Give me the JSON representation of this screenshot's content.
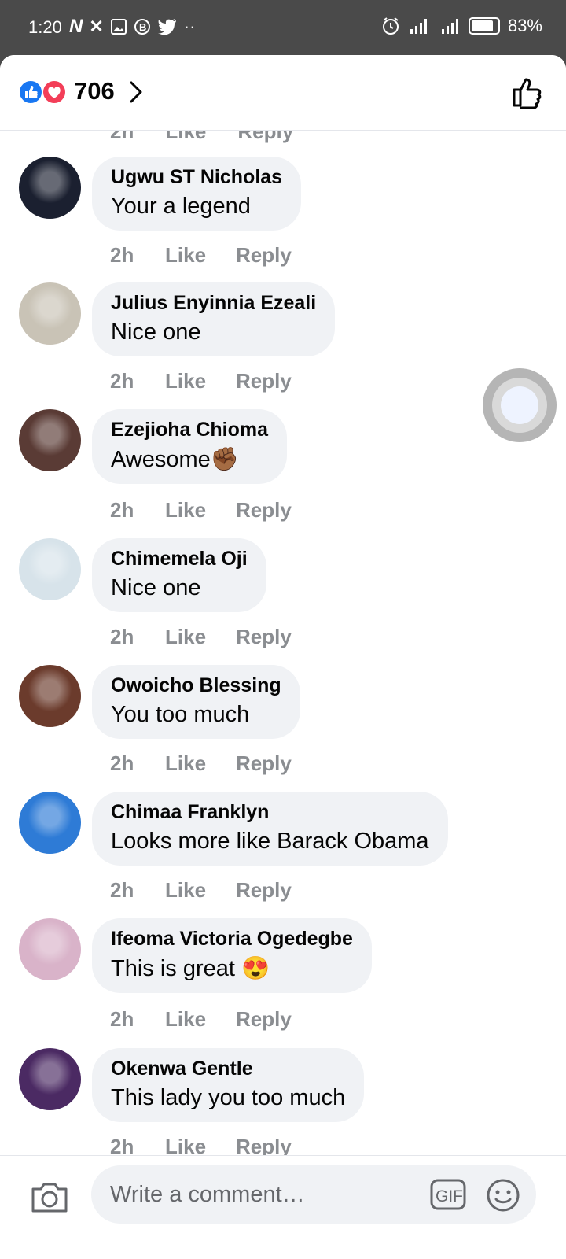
{
  "status_bar": {
    "time": "1:20",
    "battery": "83%",
    "battery_level": 0.83
  },
  "header": {
    "reaction_count": "706"
  },
  "partial_actions": {
    "time": "2h",
    "like": "Like",
    "reply": "Reply"
  },
  "comments": [
    {
      "name": "Ugwu ST Nicholas",
      "text": "Your a legend",
      "time": "2h",
      "like": "Like",
      "reply": "Reply",
      "avatar_color": "#1b2030"
    },
    {
      "name": "Julius Enyinnia Ezeali",
      "text": "Nice one",
      "time": "2h",
      "like": "Like",
      "reply": "Reply",
      "avatar_color": "#c9c3b6"
    },
    {
      "name": "Ezejioha Chioma",
      "text": "Awesome✊🏾",
      "time": "2h",
      "like": "Like",
      "reply": "Reply",
      "avatar_color": "#5a3b35"
    },
    {
      "name": "Chimemela Oji",
      "text": "Nice one",
      "time": "2h",
      "like": "Like",
      "reply": "Reply",
      "avatar_color": "#d7e3ea"
    },
    {
      "name": "Owoicho Blessing",
      "text": "You too much",
      "time": "2h",
      "like": "Like",
      "reply": "Reply",
      "avatar_color": "#6b3b2c"
    },
    {
      "name": "Chimaa Franklyn",
      "text": "Looks more like Barack Obama",
      "time": "2h",
      "like": "Like",
      "reply": "Reply",
      "avatar_color": "#2e7bd6"
    },
    {
      "name": "Ifeoma Victoria Ogedegbe",
      "text": "This is great 😍",
      "time": "2h",
      "like": "Like",
      "reply": "Reply",
      "avatar_color": "#d9b3c9"
    },
    {
      "name": "Okenwa Gentle",
      "text": "This lady you too much",
      "time": "2h",
      "like": "Like",
      "reply": "Reply",
      "avatar_color": "#4b2a63"
    }
  ],
  "composer": {
    "placeholder": "Write a comment…",
    "gif_label": "GIF"
  },
  "colors": {
    "like_blue": "#1877f2",
    "love_red": "#f33e58",
    "bubble_bg": "#f0f2f5",
    "meta_gray": "#8a8d91"
  }
}
